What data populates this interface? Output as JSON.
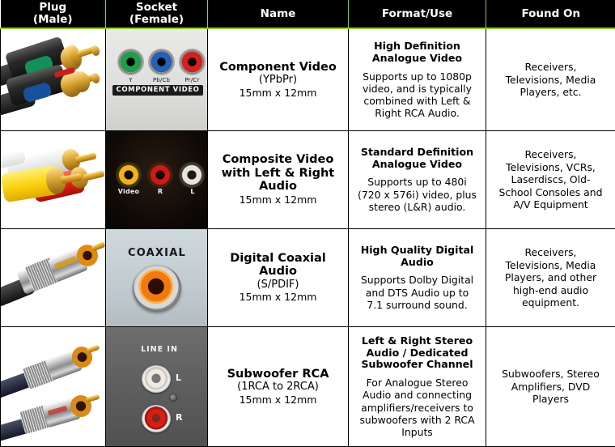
{
  "table": {
    "headers": [
      {
        "id": "plug",
        "line1": "Plug",
        "line2": "(Male)"
      },
      {
        "id": "socket",
        "line1": "Socket",
        "line2": "(Female)"
      },
      {
        "id": "name",
        "line1": "Name",
        "line2": ""
      },
      {
        "id": "format",
        "line1": "Format/Use",
        "line2": ""
      },
      {
        "id": "found",
        "line1": "Found On",
        "line2": ""
      }
    ],
    "header_bg": "#000000",
    "header_text_color": "#ffffff",
    "header_rule_color": "#8fce2a",
    "border_color": "#000000",
    "rows": [
      {
        "id": "component-video",
        "plug_image": "component-video-plug-photo",
        "socket_image": "component-video-socket-photo",
        "socket_labels": {
          "title": "COMPONENT VIDEO",
          "jacks": [
            "Y",
            "Pb/Cb",
            "Pr/Cr"
          ],
          "jack_colors": [
            "#1f9e4b",
            "#2660b8",
            "#d3211f"
          ]
        },
        "name_title": "Component Video",
        "name_sub": "(YPbPr)",
        "name_dimensions": "15mm x 12mm",
        "format_title": "High Definition Analogue Video",
        "format_desc": "Supports up to 1080p video, and is typically combined with Left & Right RCA Audio.",
        "found_on": "Receivers, Televisions, Media Players, etc."
      },
      {
        "id": "composite-video",
        "plug_image": "composite-video-plug-photo",
        "socket_image": "composite-video-socket-photo",
        "socket_labels": {
          "title": "",
          "jacks": [
            "Video",
            "R",
            "L"
          ],
          "jack_colors": [
            "#f0b419",
            "#cf1a13",
            "#e8e4da"
          ]
        },
        "name_title": "Composite Video with Left & Right Audio",
        "name_sub": "",
        "name_dimensions": "15mm x 12mm",
        "format_title": "Standard Definition Analogue Video",
        "format_desc": "Supports up to 480i (720 x 576i) video, plus stereo (L&R) audio.",
        "found_on": "Receivers, Televisions, VCRs, Laserdiscs, Old-School Consoles and A/V Equipment"
      },
      {
        "id": "digital-coaxial-audio",
        "plug_image": "digital-coaxial-plug-photo",
        "socket_image": "digital-coaxial-socket-photo",
        "socket_labels": {
          "title": "COAXIAL",
          "jacks": [],
          "jack_colors": [
            "#f07a11"
          ]
        },
        "name_title": "Digital Coaxial Audio",
        "name_sub": "(S/PDIF)",
        "name_dimensions": "15mm x 12mm",
        "format_title": "High Quality Digital Audio",
        "format_desc": "Supports Dolby Digital and DTS Audio up to 7.1 surround sound.",
        "found_on": "Receivers, Televisions, Media Players, and other high-end audio equipment."
      },
      {
        "id": "subwoofer-rca",
        "plug_image": "subwoofer-rca-plug-photo",
        "socket_image": "subwoofer-rca-socket-photo",
        "socket_labels": {
          "title": "LINE IN",
          "jacks": [
            "L",
            "R"
          ],
          "jack_colors": [
            "#eeeae0",
            "#d61f13"
          ]
        },
        "name_title": "Subwoofer RCA",
        "name_sub": "(1RCA to 2RCA)",
        "name_dimensions": "15mm x 12mm",
        "format_title": "Left & Right Stereo Audio / Dedicated Subwoofer Channel",
        "format_desc": "For Analogue Stereo Audio and connecting amplifiers/receivers to subwoofers with 2 RCA Inputs",
        "found_on": "Subwoofers, Stereo Amplifiers, DVD Players"
      }
    ]
  }
}
